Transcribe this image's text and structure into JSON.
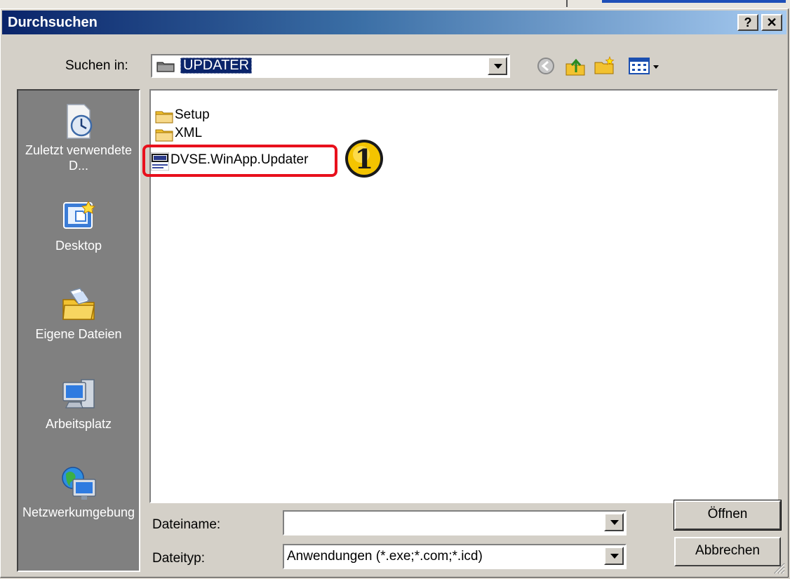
{
  "window": {
    "title": "Durchsuchen",
    "help_glyph": "?",
    "close_glyph": "✕"
  },
  "lookin": {
    "label": "Suchen in:",
    "value": "UPDATER"
  },
  "toolbar": [
    "back-icon",
    "up-folder-icon",
    "new-folder-icon",
    "view-menu-icon"
  ],
  "places": {
    "recent": "Zuletzt verwendete D...",
    "desktop": "Desktop",
    "documents": "Eigene Dateien",
    "computer": "Arbeitsplatz",
    "network": "Netzwerkumgebung"
  },
  "files": [
    {
      "name": "Setup",
      "icon": "folder-icon"
    },
    {
      "name": "XML",
      "icon": "folder-icon"
    },
    {
      "name": "DVSE.WinApp.Updater",
      "icon": "dvse-app-icon"
    }
  ],
  "annotation": {
    "marker": "1",
    "highlight_color": "#e8101c",
    "badge_color": "#f4c400"
  },
  "filename": {
    "label": "Dateiname:",
    "value": ""
  },
  "filetype": {
    "label": "Dateityp:",
    "value": "Anwendungen (*.exe;*.com;*.icd)"
  },
  "buttons": {
    "open": "Öffnen",
    "cancel": "Abbrechen"
  },
  "colors": {
    "title_start": "#0a246a",
    "title_end": "#a6caf0",
    "face": "#d4d0c8",
    "places_bg": "#808080"
  }
}
